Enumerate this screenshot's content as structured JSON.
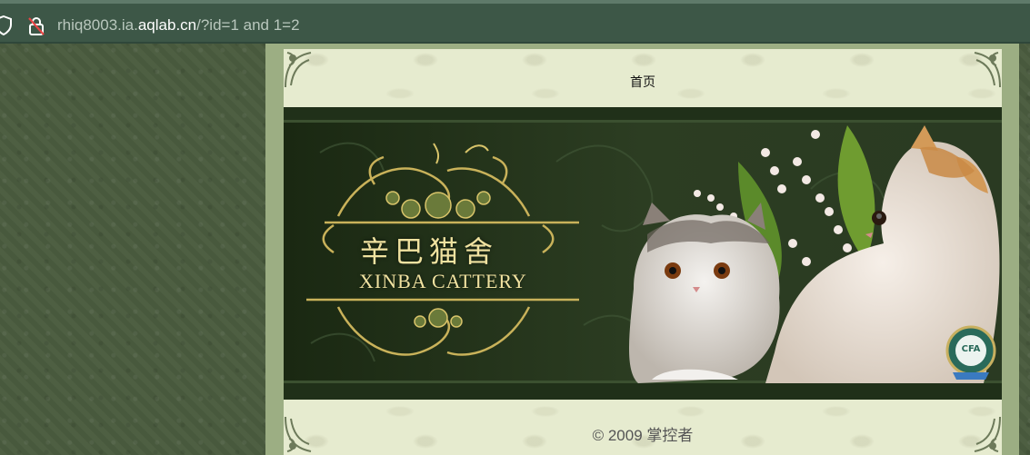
{
  "browser": {
    "url_prefix": "rhiq8003.ia.",
    "url_domain": "aqlab.cn",
    "url_path": "/?id=1 and 1=2",
    "icons": [
      "shield-icon",
      "lock-insecure-icon"
    ]
  },
  "page": {
    "nav": {
      "home_label": "首页"
    },
    "banner": {
      "title_cn": "辛巴猫舍",
      "title_en": "XINBA CATTERY",
      "badge_text": "CFA"
    },
    "footer": {
      "copyright": "© 2009 掌控者"
    }
  },
  "colors": {
    "background": "#4a5b3e",
    "browser_bar": "#3d5747",
    "frame": "#9cae83",
    "page": "#e6ebcf",
    "banner_dark": "#1c2a15",
    "banner_gold": "#f0e2a0"
  }
}
